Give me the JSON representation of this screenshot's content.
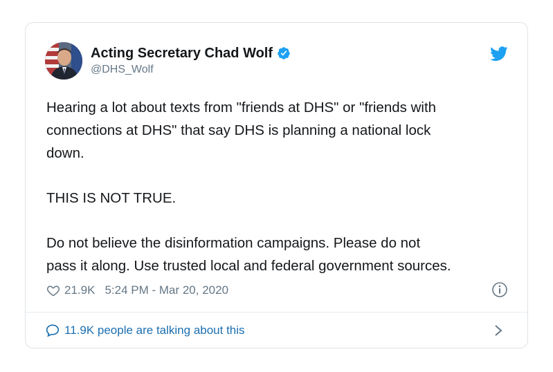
{
  "tweet": {
    "display_name": "Acting Secretary Chad Wolf",
    "handle": "@DHS_Wolf",
    "paragraphs": [
      "Hearing a lot about texts from \"friends at DHS\" or \"friends with\nconnections at DHS\" that say DHS is planning a national lock\ndown.",
      "THIS IS NOT TRUE.",
      "Do not believe the disinformation campaigns. Please do not\npass it along. Use trusted local and federal government sources."
    ],
    "likes": "21.9K",
    "timestamp": "5:24 PM - Mar 20, 2020",
    "talking": "11.9K people are talking about this"
  },
  "colors": {
    "twitter_blue": "#1da1f2",
    "text_dark": "#14171a",
    "text_muted": "#657786",
    "link_blue": "#1b6fb0"
  },
  "icons": [
    "verified-badge-icon",
    "twitter-bird-icon",
    "heart-icon",
    "info-icon",
    "speech-bubble-icon",
    "chevron-right-icon"
  ]
}
